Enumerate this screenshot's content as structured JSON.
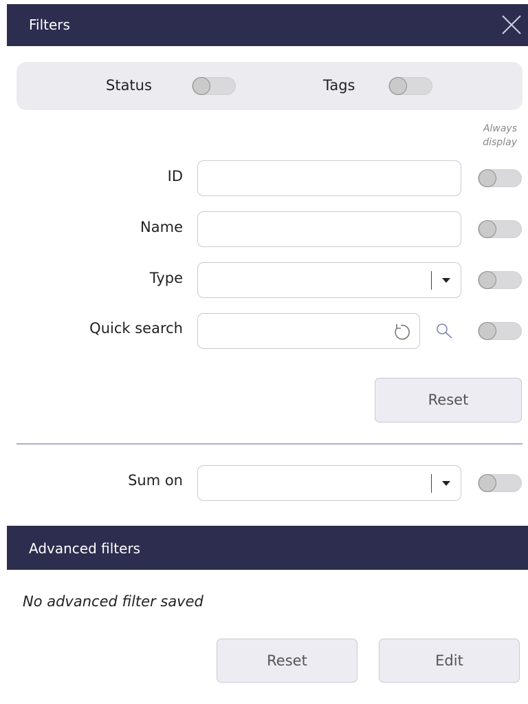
{
  "filters_header": {
    "title": "Filters"
  },
  "toggles_bar": {
    "status_label": "Status",
    "tags_label": "Tags"
  },
  "always_display": {
    "line1": "Always",
    "line2": "display"
  },
  "fields": {
    "id_label": "ID",
    "name_label": "Name",
    "type_label": "Type",
    "quick_search_label": "Quick search"
  },
  "reset_button_label": "Reset",
  "sum_on_label": "Sum on",
  "advanced": {
    "title": "Advanced filters",
    "empty_text": "No advanced filter saved",
    "reset_label": "Reset",
    "edit_label": "Edit"
  },
  "icons": {
    "close": "close-icon",
    "dropdown": "chevron-down-icon",
    "refresh": "refresh-icon",
    "search": "search-icon"
  },
  "colors": {
    "header_bg": "#2d2d4f",
    "toggle_bar_bg": "#ececf0",
    "button_bg": "#ececf2",
    "divider": "#b0adc9"
  },
  "switch_states": {
    "status": false,
    "tags": false,
    "id_always_display": false,
    "name_always_display": false,
    "type_always_display": false,
    "quick_search_always_display": false,
    "sum_on_always_display": false
  }
}
